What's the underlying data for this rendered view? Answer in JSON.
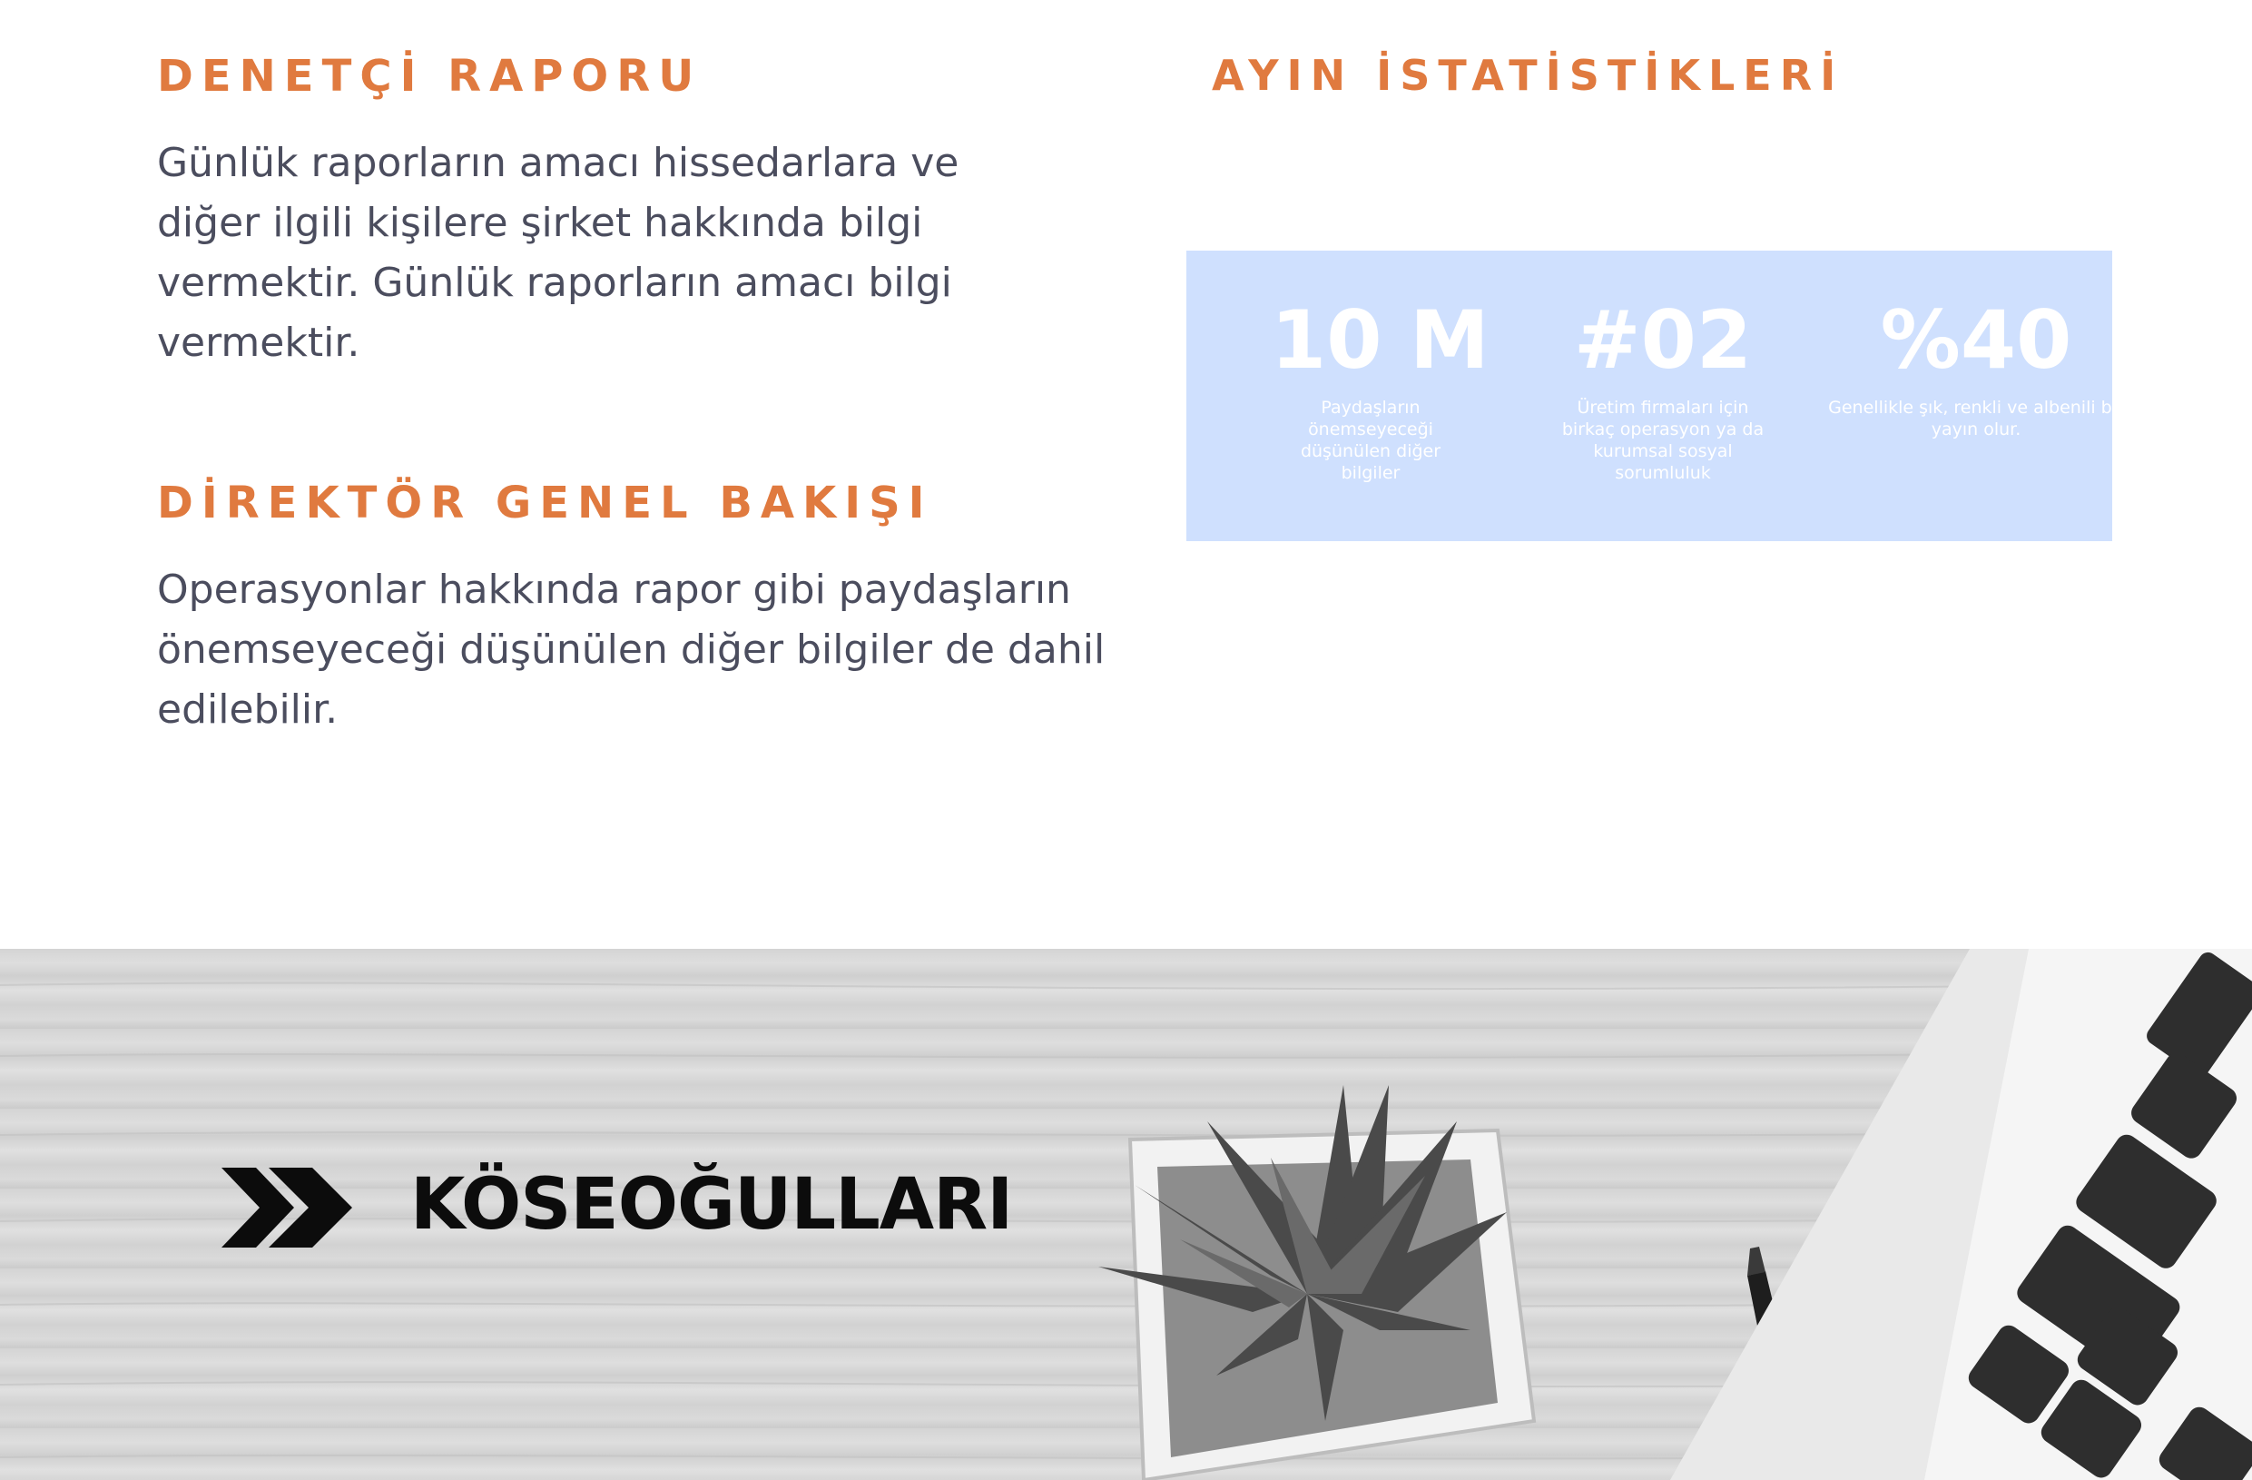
{
  "sections": [
    {
      "title": "DENETÇİ RAPORU",
      "body": "Günlük raporların amacı hissedarlara ve diğer ilgili kişilere şirket hakkında bilgi vermektir. Günlük raporların amacı bilgi vermektir."
    },
    {
      "title": "DİREKTÖR GENEL BAKIŞI",
      "body": "Operasyonlar hakkında rapor gibi paydaşların önemseyeceği düşünülen diğer bilgiler de dahil edilebilir."
    }
  ],
  "stats": {
    "title": "AYIN  İSTATİSTİKLERİ",
    "items": [
      {
        "value": "10 M",
        "description": "Paydaşların önemseyeceği düşünülen diğer bilgiler"
      },
      {
        "value": "#02",
        "description": "Üretim firmaları için birkaç operasyon ya da kurumsal sosyal sorumluluk"
      },
      {
        "value": "%40",
        "description": "Genellikle şık, renkli ve albenili bir yayın olur."
      }
    ]
  },
  "footer": {
    "brand": "KÖSEOĞULLARI",
    "logo_icon": "double-chevron-right-icon"
  },
  "colors": {
    "accent": "#e07a3f",
    "text": "#4b4d5e",
    "stats_bg": "#cfe0fe"
  }
}
